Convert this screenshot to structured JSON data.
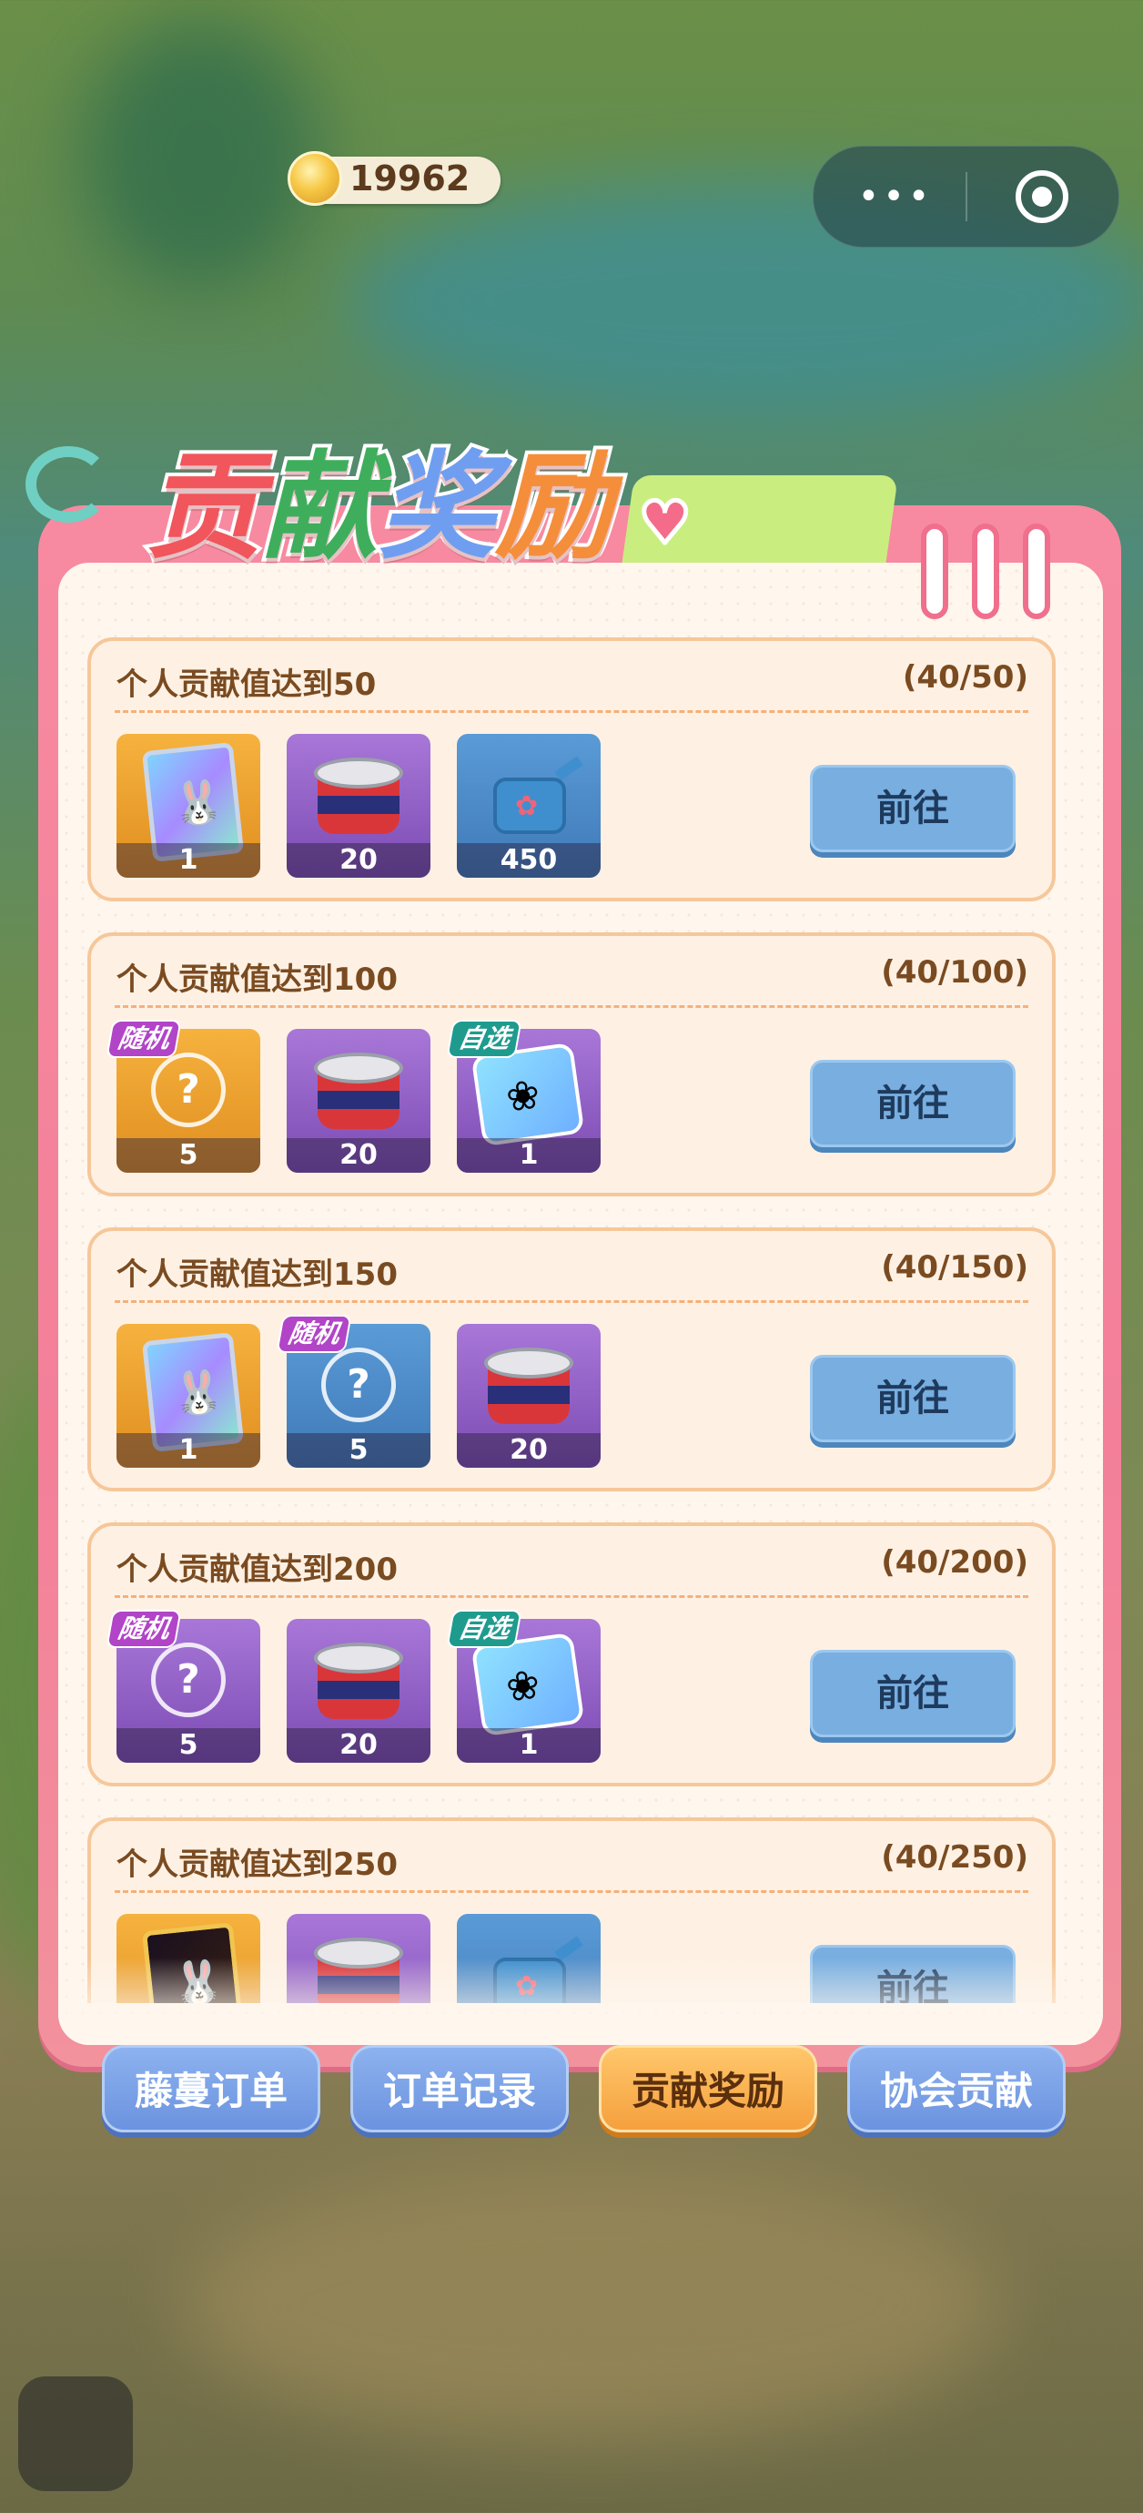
{
  "topbar": {
    "coin_value": "19962",
    "coin_icon": "gold-coin-icon",
    "menu_icon": "more-dots-icon",
    "close_icon": "target-close-icon"
  },
  "panel": {
    "title_chars": [
      "贡",
      "献",
      "奖",
      "励"
    ],
    "title_colors": [
      "#f0565c",
      "#3fae5c",
      "#6f9ef0",
      "#f58e3a"
    ]
  },
  "rows": [
    {
      "title": "个人贡献值达到50",
      "progress": "(40/50)",
      "button": "前往",
      "items": [
        {
          "kind": "rabbit-card",
          "count": "1",
          "tag": ""
        },
        {
          "kind": "can",
          "count": "20",
          "tag": ""
        },
        {
          "kind": "watering-can",
          "count": "450",
          "tag": ""
        }
      ]
    },
    {
      "title": "个人贡献值达到100",
      "progress": "(40/100)",
      "button": "前往",
      "items": [
        {
          "kind": "spirit-gold",
          "count": "5",
          "tag": "随机"
        },
        {
          "kind": "can",
          "count": "20",
          "tag": ""
        },
        {
          "kind": "seed-bag",
          "count": "1",
          "tag": "自选"
        }
      ]
    },
    {
      "title": "个人贡献值达到150",
      "progress": "(40/150)",
      "button": "前往",
      "items": [
        {
          "kind": "rabbit-card",
          "count": "1",
          "tag": ""
        },
        {
          "kind": "spirit-blue",
          "count": "5",
          "tag": "随机"
        },
        {
          "kind": "can",
          "count": "20",
          "tag": ""
        }
      ]
    },
    {
      "title": "个人贡献值达到200",
      "progress": "(40/200)",
      "button": "前往",
      "items": [
        {
          "kind": "spirit-purple",
          "count": "5",
          "tag": "随机"
        },
        {
          "kind": "can",
          "count": "20",
          "tag": ""
        },
        {
          "kind": "seed-bag",
          "count": "1",
          "tag": "自选"
        }
      ]
    },
    {
      "title": "个人贡献值达到250",
      "progress": "(40/250)",
      "button": "前往",
      "items": [
        {
          "kind": "rabbit-card-dark",
          "count": "",
          "tag": ""
        },
        {
          "kind": "can",
          "count": "",
          "tag": ""
        },
        {
          "kind": "watering-can",
          "count": "",
          "tag": ""
        }
      ]
    }
  ],
  "tabs": [
    {
      "label": "藤蔓订单",
      "active": false
    },
    {
      "label": "订单记录",
      "active": false
    },
    {
      "label": "贡献奖励",
      "active": true
    },
    {
      "label": "协会贡献",
      "active": false
    }
  ]
}
